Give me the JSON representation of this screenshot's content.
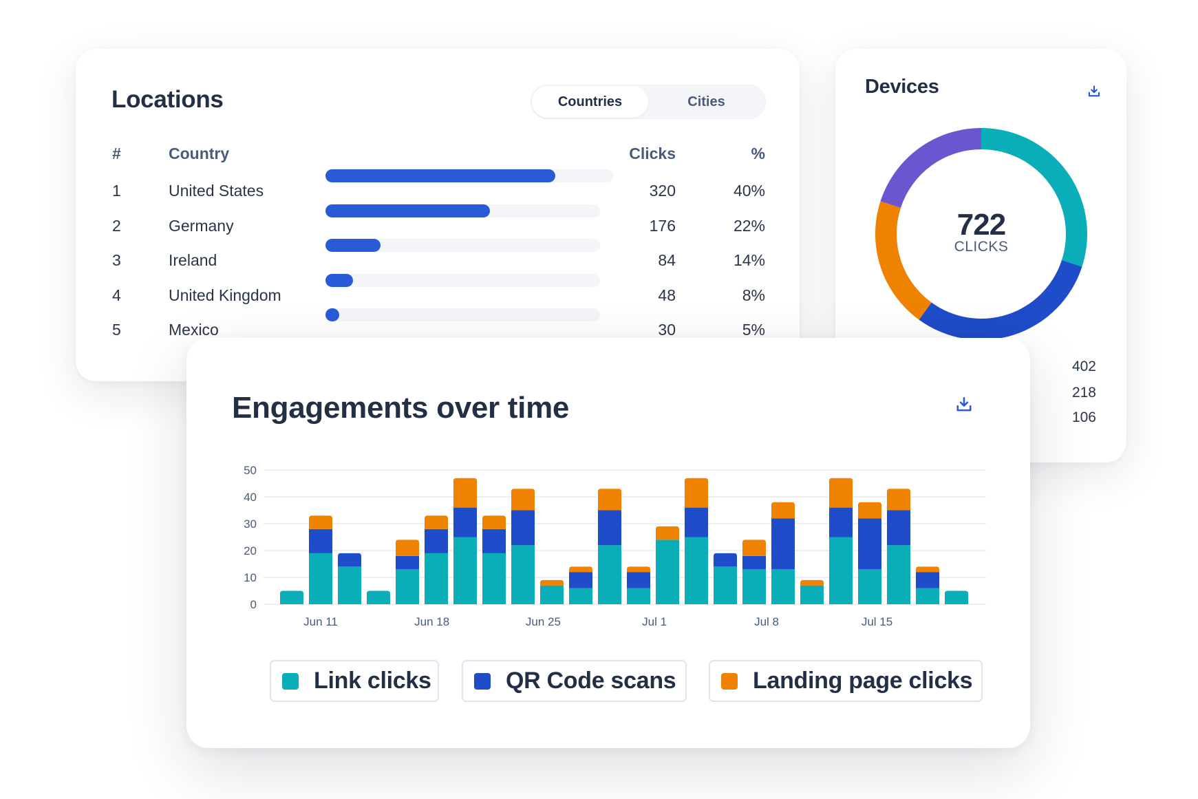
{
  "colors": {
    "link_clicks": "#0aaeb8",
    "qr_code_scans": "#1f4cc8",
    "landing_page_clicks": "#ef8200",
    "purple": "#6b56cf",
    "accent_blue": "#2a5bd7",
    "track": "#f3f5f9"
  },
  "locations": {
    "title": "Locations",
    "toggle": {
      "options": [
        "Countries",
        "Cities"
      ],
      "selected": "Countries"
    },
    "columns": {
      "rank": "#",
      "country": "Country",
      "clicks": "Clicks",
      "percent": "%"
    },
    "rows": [
      {
        "rank": "1",
        "country": "United States",
        "clicks": "320",
        "percent": "40%",
        "bar_fraction": 0.8
      },
      {
        "rank": "2",
        "country": "Germany",
        "clicks": "176",
        "percent": "22%",
        "bar_fraction": 0.6
      },
      {
        "rank": "3",
        "country": "Ireland",
        "clicks": "84",
        "percent": "14%",
        "bar_fraction": 0.2
      },
      {
        "rank": "4",
        "country": "United Kingdom",
        "clicks": "48",
        "percent": "8%",
        "bar_fraction": 0.1
      },
      {
        "rank": "5",
        "country": "Mexico",
        "clicks": "30",
        "percent": "5%",
        "bar_fraction": 0.05
      }
    ]
  },
  "devices": {
    "title": "Devices",
    "download_icon": "download-icon",
    "total": "722",
    "total_label": "CLICKS",
    "visible_values": [
      "402",
      "218",
      "106"
    ]
  },
  "engagements": {
    "title": "Engagements over time",
    "download_icon": "download-icon"
  },
  "chart_data": [
    {
      "type": "bar",
      "stacked": true,
      "title": "Engagements over time",
      "xlabel": "",
      "ylabel": "",
      "ylim": [
        0,
        50
      ],
      "yticks": [
        0,
        10,
        20,
        30,
        40,
        50
      ],
      "grid": true,
      "legend_position": "bottom",
      "x_tick_labels": [
        "Jun 11",
        "Jun 18",
        "Jun 25",
        "Jul 1",
        "Jul 8",
        "Jul 15"
      ],
      "categories": [
        "1",
        "2",
        "3",
        "4",
        "5",
        "6",
        "7",
        "8",
        "9",
        "10",
        "11",
        "12",
        "13",
        "14",
        "15",
        "16",
        "17",
        "18",
        "19",
        "20",
        "21",
        "22",
        "23",
        "24"
      ],
      "series": [
        {
          "name": "Link clicks",
          "color": "#0aaeb8",
          "values": [
            5,
            19,
            14,
            5,
            13,
            19,
            25,
            19,
            22,
            7,
            6,
            22,
            6,
            24,
            25,
            14,
            13,
            13,
            7,
            25,
            13,
            22,
            6,
            5
          ]
        },
        {
          "name": "QR Code scans",
          "color": "#1f4cc8",
          "values": [
            0,
            9,
            5,
            0,
            5,
            9,
            11,
            9,
            13,
            0,
            6,
            13,
            6,
            0,
            11,
            5,
            5,
            19,
            0,
            11,
            19,
            13,
            6,
            0
          ]
        },
        {
          "name": "Landing page clicks",
          "color": "#ef8200",
          "values": [
            0,
            5,
            0,
            0,
            6,
            5,
            11,
            5,
            8,
            2,
            2,
            8,
            2,
            5,
            11,
            0,
            6,
            6,
            2,
            11,
            6,
            8,
            2,
            0
          ]
        }
      ]
    },
    {
      "type": "pie",
      "donut": true,
      "title": "Devices",
      "center_text": "722 CLICKS",
      "slices": [
        {
          "name": "segment-1",
          "share": 0.3,
          "color": "#0aaeb8"
        },
        {
          "name": "segment-2",
          "share": 0.3,
          "color": "#1f4cc8"
        },
        {
          "name": "segment-3",
          "share": 0.2,
          "color": "#ef8200"
        },
        {
          "name": "segment-4",
          "share": 0.2,
          "color": "#6b56cf"
        }
      ]
    }
  ]
}
